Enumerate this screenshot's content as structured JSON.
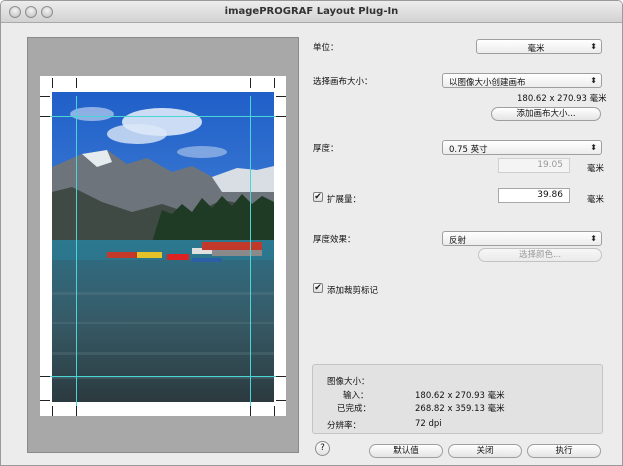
{
  "window": {
    "title": "imagePROGRAF Layout Plug-In"
  },
  "unit": {
    "label": "单位：",
    "value": "毫米"
  },
  "canvas_size": {
    "label": "选择画布大小：",
    "value": "以图像大小创建画布",
    "dimensions": "180.62 x 270.93 毫米",
    "add_button": "添加画布大小..."
  },
  "thickness": {
    "label": "厚度：",
    "value": "0.75 英寸",
    "mm_value": "19.05",
    "unit": "毫米"
  },
  "extension": {
    "label": "扩展量：",
    "checked": true,
    "value": "39.86",
    "unit": "毫米"
  },
  "thickness_effect": {
    "label": "厚度效果：",
    "value": "反射",
    "select_color_button": "选择颜色..."
  },
  "crop_marks": {
    "label": "添加裁剪标记",
    "checked": true
  },
  "image_info": {
    "title": "图像大小：",
    "input_label": "输入：",
    "input_value": "180.62 x 270.93 毫米",
    "done_label": "已完成：",
    "done_value": "268.82 x 359.13 毫米",
    "resolution_label": "分辨率：",
    "resolution_value": "72 dpi"
  },
  "buttons": {
    "help": "?",
    "default": "默认值",
    "close": "关闭",
    "run": "执行"
  }
}
